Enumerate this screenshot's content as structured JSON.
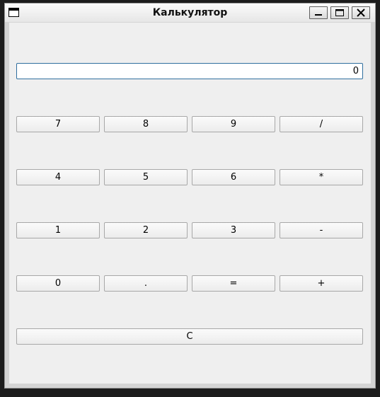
{
  "window": {
    "title": "Калькулятор",
    "controls": [
      "minimize-icon",
      "maximize-icon",
      "close-icon"
    ]
  },
  "display": {
    "value": "0"
  },
  "keypad": {
    "rows": [
      [
        "7",
        "8",
        "9",
        "/"
      ],
      [
        "4",
        "5",
        "6",
        "*"
      ],
      [
        "1",
        "2",
        "3",
        "-"
      ],
      [
        "0",
        ".",
        "=",
        "+"
      ]
    ],
    "clear_label": "C"
  },
  "colors": {
    "display_border": "#2f6e9e",
    "window_background": "#efefef",
    "desktop": "#1d1d1d"
  }
}
